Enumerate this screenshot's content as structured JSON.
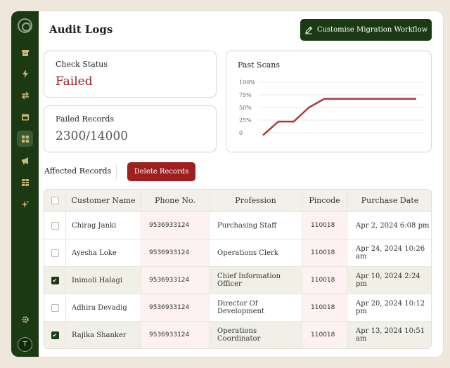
{
  "page": {
    "title": "Audit Logs"
  },
  "actions": {
    "customise_label": "Customise Migration Workflow",
    "delete_label": "Delete Records"
  },
  "sidebar": {
    "items": [
      {
        "icon": "archive-icon"
      },
      {
        "icon": "lightning-icon"
      },
      {
        "icon": "transfer-icon"
      },
      {
        "icon": "table-icon"
      },
      {
        "icon": "grid-icon",
        "active": true
      },
      {
        "icon": "megaphone-icon"
      },
      {
        "icon": "database-icon"
      },
      {
        "icon": "sparkle-icon"
      }
    ],
    "settings_icon": "gear-icon",
    "avatar_initial": "T"
  },
  "check_status": {
    "label": "Check Status",
    "value": "Failed"
  },
  "failed_records": {
    "label": "Failed Records",
    "value": "2300/14000"
  },
  "chart_data": {
    "type": "line",
    "title": "Past Scans",
    "y_ticks": [
      "100%",
      "75%",
      "50%",
      "25%",
      "0"
    ],
    "ylim": [
      0,
      100
    ],
    "x": [
      1,
      2,
      3,
      4,
      5,
      6,
      7,
      8,
      9,
      10,
      11
    ],
    "values": [
      -5,
      22,
      22,
      50,
      67,
      67,
      67,
      67,
      67,
      67,
      67
    ],
    "color": "#b03a3a"
  },
  "affected": {
    "label": "Affected Records"
  },
  "table": {
    "columns": [
      "Customer Name",
      "Phone No.",
      "Profession",
      "Pincode",
      "Purchase Date"
    ],
    "rows": [
      {
        "checked": false,
        "name": "Chirag Janki",
        "phone": "9536933124",
        "profession": "Purchasing Staff",
        "pincode": "110018",
        "date": "Apr 2, 2024 6:08 pm"
      },
      {
        "checked": false,
        "name": "Ayesha Loke",
        "phone": "9536933124",
        "profession": "Operations Clerk",
        "pincode": "110018",
        "date": "Apr 24, 2024 10:26 am"
      },
      {
        "checked": true,
        "name": "Inimoli Halagi",
        "phone": "9536933124",
        "profession": "Chief Information Officer",
        "pincode": "110018",
        "date": "Apr 10, 2024 2:24 pm"
      },
      {
        "checked": false,
        "name": "Adhira Devadig",
        "phone": "9536933124",
        "profession": "Director Of Development",
        "pincode": "110018",
        "date": "Apr 20, 2024 10:12 pm"
      },
      {
        "checked": true,
        "name": "Rajika Shanker",
        "phone": "9536933124",
        "profession": "Operations Coordinator",
        "pincode": "110018",
        "date": "Apr 13, 2024 10:51 am"
      }
    ]
  },
  "colors": {
    "brand": "#1b3a14",
    "danger": "#9e1f1f",
    "failed_text": "#9b2222"
  }
}
